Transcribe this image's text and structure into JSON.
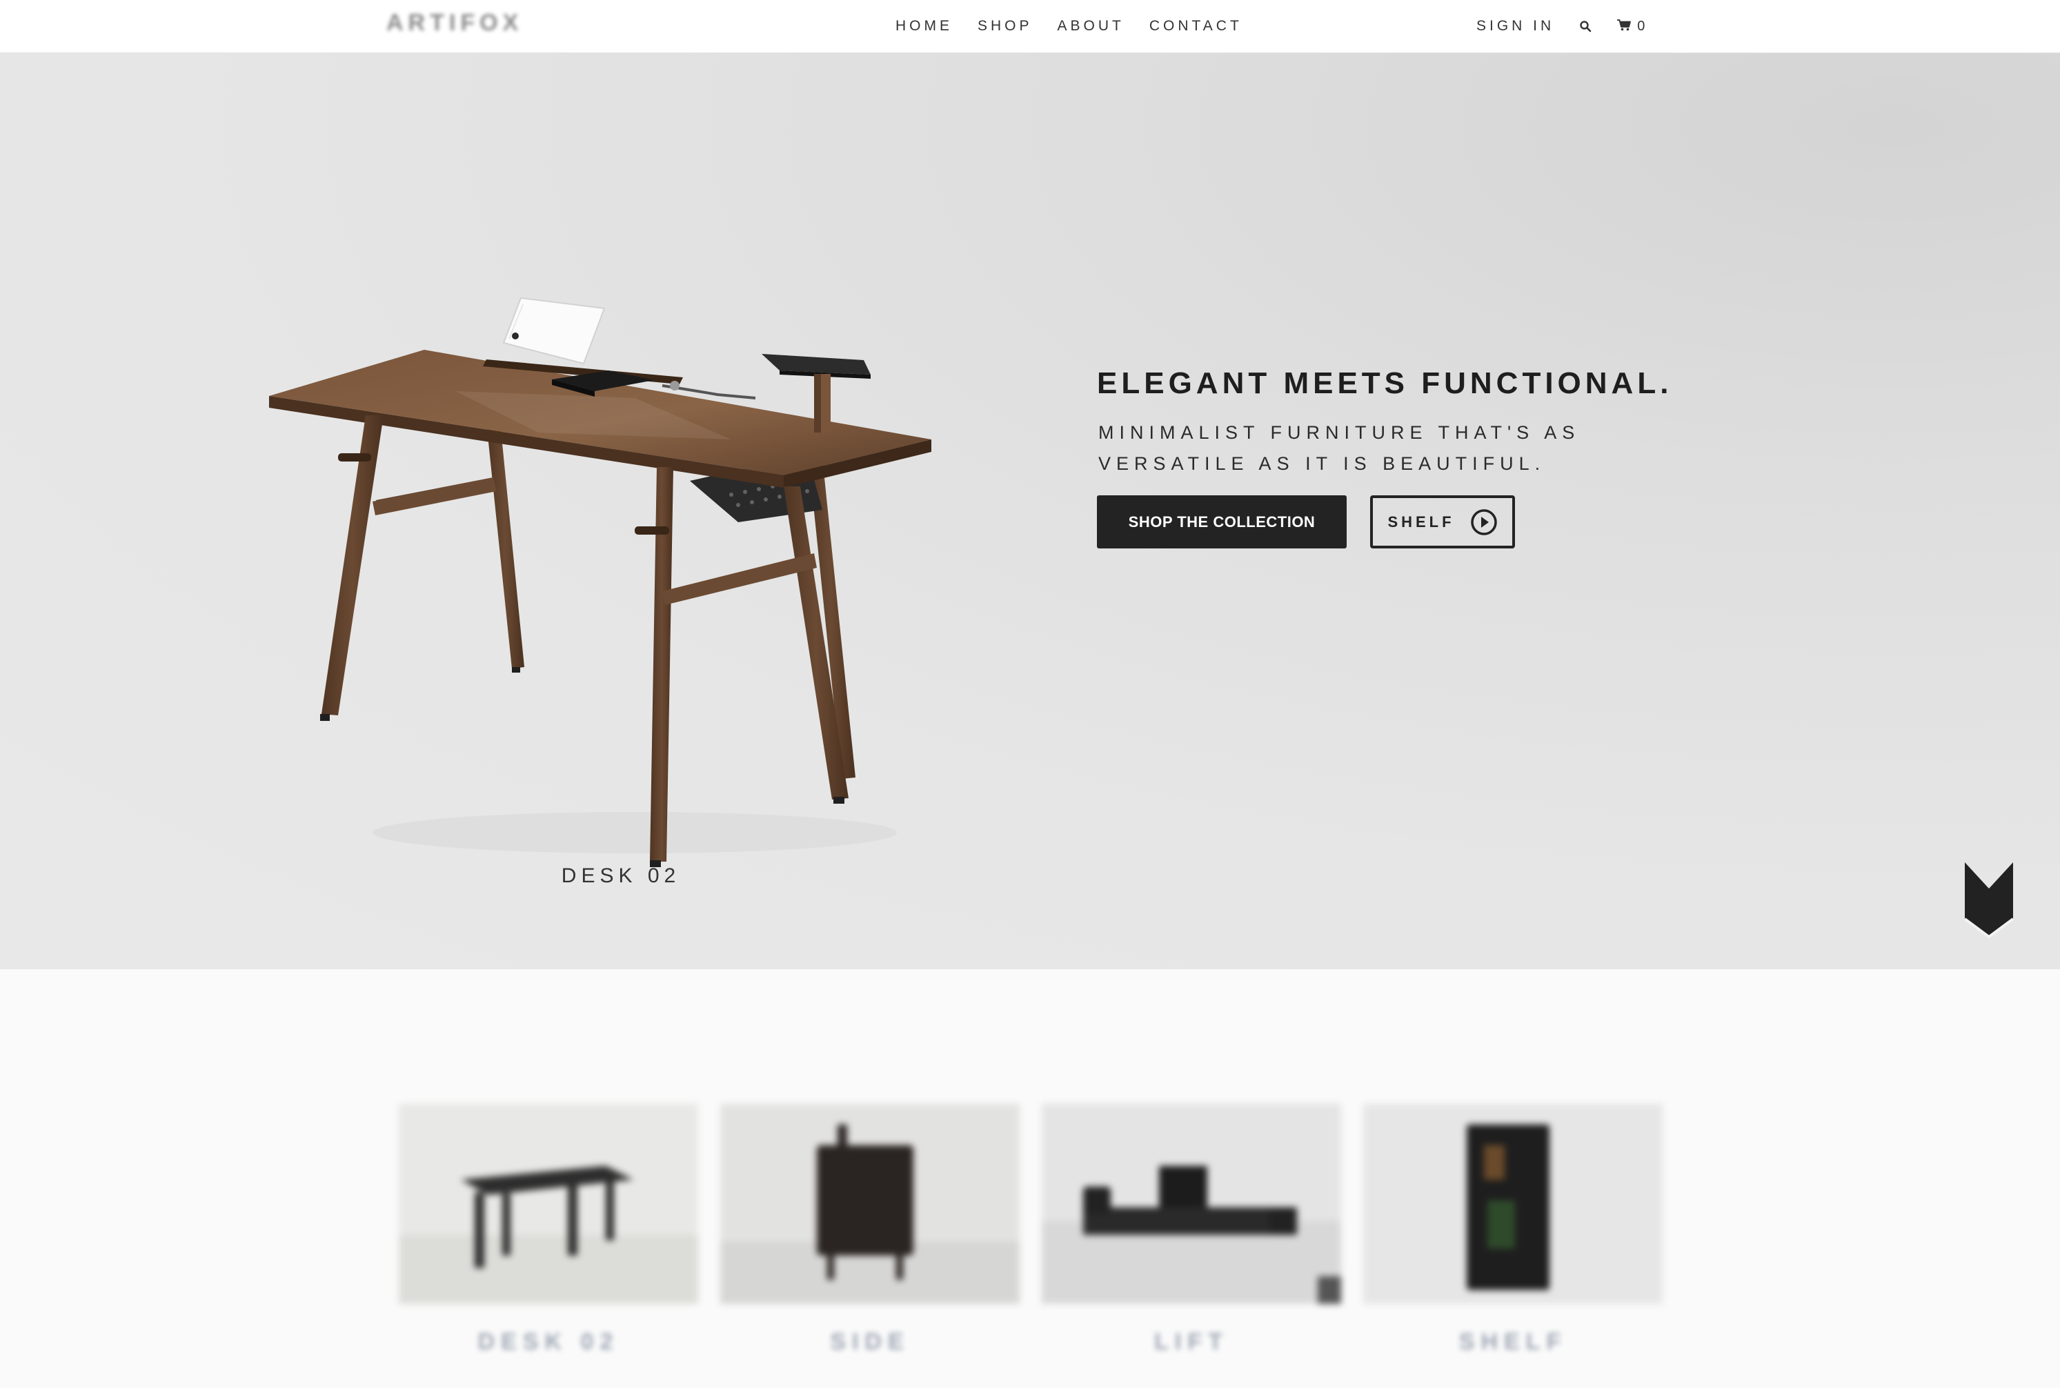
{
  "brand": {
    "logo_text": "ARTIFOX"
  },
  "nav": {
    "items": [
      "HOME",
      "SHOP",
      "ABOUT",
      "CONTACT"
    ]
  },
  "account": {
    "sign_in": "SIGN IN",
    "search_icon": "search-icon",
    "cart_icon": "cart-icon",
    "cart_count": "0"
  },
  "hero": {
    "headline": "ELEGANT MEETS FUNCTIONAL.",
    "subhead": "MINIMALIST FURNITURE THAT'S AS VERSATILE AS IT IS BEAUTIFUL.",
    "primary_button": "SHOP THE COLLECTION",
    "secondary_button": "SHELF",
    "secondary_icon": "play-circle-icon",
    "product_caption": "DESK 02",
    "scroll_icon": "chevron-down-icon"
  },
  "products": [
    {
      "label": "DESK 02"
    },
    {
      "label": "SIDE"
    },
    {
      "label": "LIFT"
    },
    {
      "label": "SHELF"
    }
  ],
  "colors": {
    "accent_dark": "#232323",
    "hero_bg": "#e6e6e6",
    "wood": "#6b4a33"
  }
}
